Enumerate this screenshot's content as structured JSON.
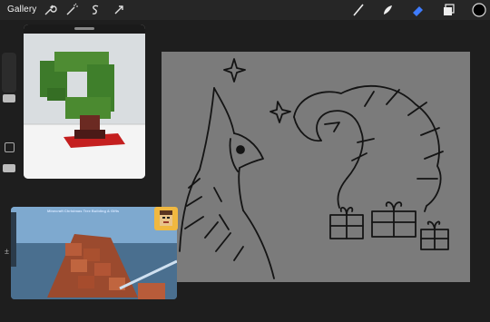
{
  "topbar": {
    "gallery_label": "Gallery",
    "left_tools": [
      "wrench-icon",
      "magic-wand-icon",
      "selection-s-icon",
      "move-arrow-icon"
    ],
    "right_tools": [
      "brush-icon",
      "smudge-icon",
      "eraser-icon",
      "layers-icon",
      "color-swatch"
    ],
    "accent_color": "#3f7cff",
    "color_swatch": "#000000"
  },
  "canvas": {
    "background": "#7b7b7b",
    "stroke_color": "#141414"
  },
  "reference_video": {
    "title": "Minecraft Christmas Tree Building & Gifts"
  }
}
